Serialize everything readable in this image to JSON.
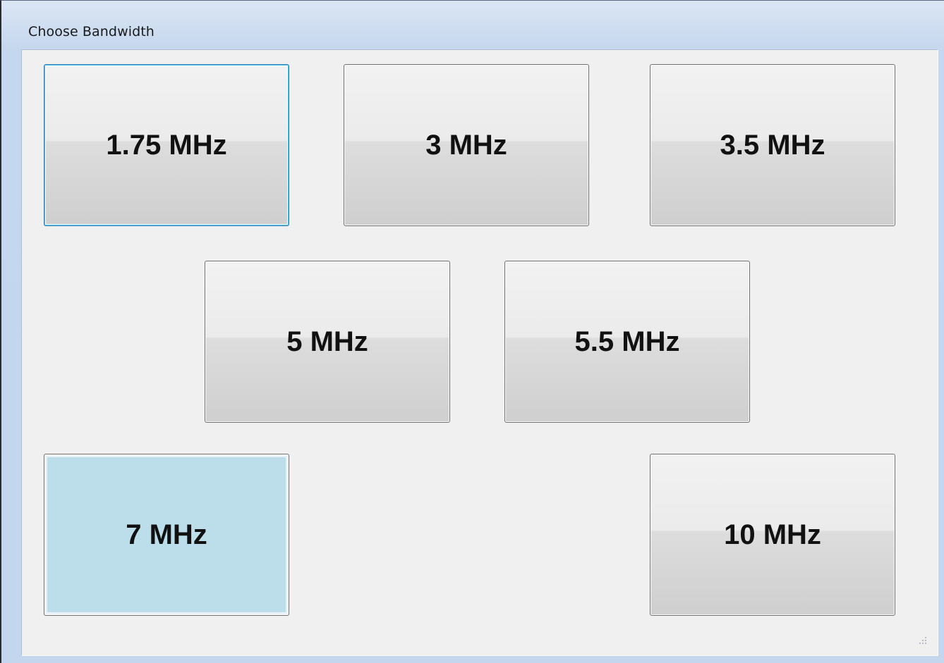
{
  "window": {
    "title": "Choose Bandwidth"
  },
  "buttons": [
    {
      "label": "1.75 MHz",
      "state": "focused"
    },
    {
      "label": "3 MHz",
      "state": "normal"
    },
    {
      "label": "3.5 MHz",
      "state": "normal"
    },
    {
      "label": "5 MHz",
      "state": "normal"
    },
    {
      "label": "5.5 MHz",
      "state": "normal"
    },
    {
      "label": "7 MHz",
      "state": "selected"
    },
    {
      "label": "10 MHz",
      "state": "normal"
    }
  ],
  "colors": {
    "selected_fill": "#bcdeea",
    "focus_border": "#48c0f0",
    "client_bg": "#f0f0f0",
    "frame": "#c4d6ed"
  },
  "icons": {
    "resize_grip": "resize-grip-icon"
  }
}
